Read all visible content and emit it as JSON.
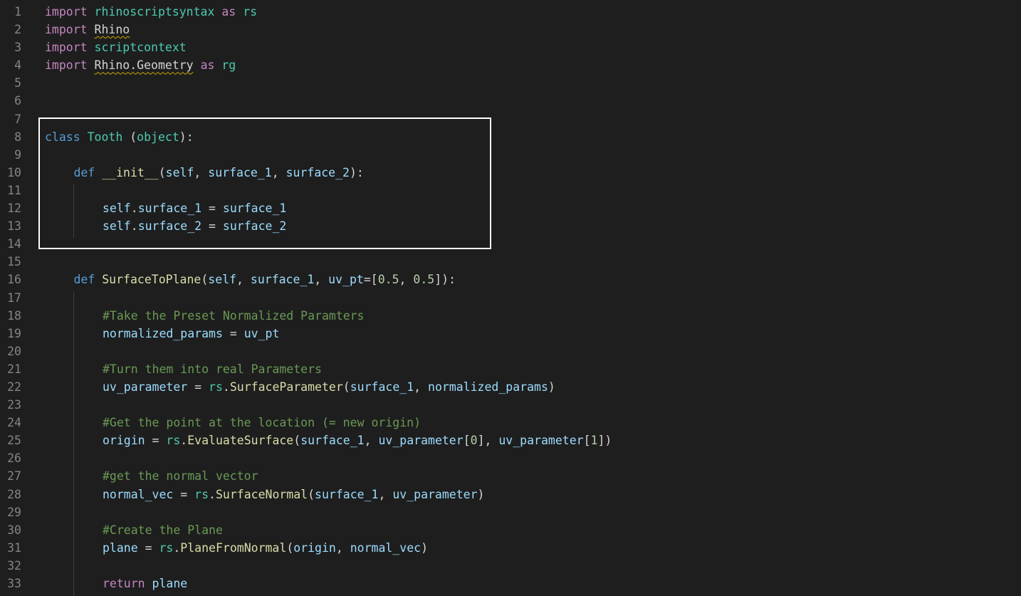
{
  "lines": [
    {
      "n": "1",
      "indent": 0,
      "tokens": [
        {
          "t": "import",
          "c": "ctrl"
        },
        {
          "t": " ",
          "c": "pl"
        },
        {
          "t": "rhinoscriptsyntax",
          "c": "cls"
        },
        {
          "t": " ",
          "c": "pl"
        },
        {
          "t": "as",
          "c": "ctrl"
        },
        {
          "t": " ",
          "c": "pl"
        },
        {
          "t": "rs",
          "c": "cls"
        }
      ]
    },
    {
      "n": "2",
      "indent": 0,
      "tokens": [
        {
          "t": "import",
          "c": "ctrl"
        },
        {
          "t": " ",
          "c": "pl"
        },
        {
          "t": "Rhino",
          "c": "pl",
          "squig": true
        }
      ]
    },
    {
      "n": "3",
      "indent": 0,
      "tokens": [
        {
          "t": "import",
          "c": "ctrl"
        },
        {
          "t": " ",
          "c": "pl"
        },
        {
          "t": "scriptcontext",
          "c": "cls"
        }
      ]
    },
    {
      "n": "4",
      "indent": 0,
      "tokens": [
        {
          "t": "import",
          "c": "ctrl"
        },
        {
          "t": " ",
          "c": "pl"
        },
        {
          "t": "Rhino.Geometry",
          "c": "pl",
          "squig": true
        },
        {
          "t": " ",
          "c": "pl"
        },
        {
          "t": "as",
          "c": "ctrl"
        },
        {
          "t": " ",
          "c": "pl"
        },
        {
          "t": "rg",
          "c": "cls"
        }
      ]
    },
    {
      "n": "5",
      "indent": 0,
      "tokens": []
    },
    {
      "n": "6",
      "indent": 0,
      "tokens": []
    },
    {
      "n": "7",
      "indent": 0,
      "tokens": []
    },
    {
      "n": "8",
      "indent": 0,
      "tokens": [
        {
          "t": "class",
          "c": "kw"
        },
        {
          "t": " ",
          "c": "pl"
        },
        {
          "t": "Tooth",
          "c": "cls"
        },
        {
          "t": " (",
          "c": "pl"
        },
        {
          "t": "object",
          "c": "cls"
        },
        {
          "t": "):",
          "c": "pl"
        }
      ]
    },
    {
      "n": "9",
      "indent": 0,
      "tokens": []
    },
    {
      "n": "10",
      "indent": 1,
      "tokens": [
        {
          "t": "def",
          "c": "kw"
        },
        {
          "t": " ",
          "c": "pl"
        },
        {
          "t": "__init__",
          "c": "fn"
        },
        {
          "t": "(",
          "c": "pl"
        },
        {
          "t": "self",
          "c": "var"
        },
        {
          "t": ", ",
          "c": "pl"
        },
        {
          "t": "surface_1",
          "c": "var"
        },
        {
          "t": ", ",
          "c": "pl"
        },
        {
          "t": "surface_2",
          "c": "var"
        },
        {
          "t": "):",
          "c": "pl"
        }
      ]
    },
    {
      "n": "11",
      "indent": 0,
      "tokens": []
    },
    {
      "n": "12",
      "indent": 2,
      "tokens": [
        {
          "t": "self",
          "c": "var"
        },
        {
          "t": ".",
          "c": "pl"
        },
        {
          "t": "surface_1",
          "c": "var"
        },
        {
          "t": " = ",
          "c": "pl"
        },
        {
          "t": "surface_1",
          "c": "var"
        }
      ]
    },
    {
      "n": "13",
      "indent": 2,
      "tokens": [
        {
          "t": "self",
          "c": "var"
        },
        {
          "t": ".",
          "c": "pl"
        },
        {
          "t": "surface_2",
          "c": "var"
        },
        {
          "t": " = ",
          "c": "pl"
        },
        {
          "t": "surface_2",
          "c": "var"
        }
      ]
    },
    {
      "n": "14",
      "indent": 0,
      "tokens": []
    },
    {
      "n": "15",
      "indent": 0,
      "tokens": []
    },
    {
      "n": "16",
      "indent": 1,
      "tokens": [
        {
          "t": "def",
          "c": "kw"
        },
        {
          "t": " ",
          "c": "pl"
        },
        {
          "t": "SurfaceToPlane",
          "c": "fn"
        },
        {
          "t": "(",
          "c": "pl"
        },
        {
          "t": "self",
          "c": "var"
        },
        {
          "t": ", ",
          "c": "pl"
        },
        {
          "t": "surface_1",
          "c": "var"
        },
        {
          "t": ", ",
          "c": "pl"
        },
        {
          "t": "uv_pt",
          "c": "var"
        },
        {
          "t": "=[",
          "c": "pl"
        },
        {
          "t": "0.5",
          "c": "num"
        },
        {
          "t": ", ",
          "c": "pl"
        },
        {
          "t": "0.5",
          "c": "num"
        },
        {
          "t": "]):",
          "c": "pl"
        }
      ]
    },
    {
      "n": "17",
      "indent": 0,
      "tokens": []
    },
    {
      "n": "18",
      "indent": 2,
      "tokens": [
        {
          "t": "#Take the Preset Normalized Paramters",
          "c": "cmt"
        }
      ]
    },
    {
      "n": "19",
      "indent": 2,
      "tokens": [
        {
          "t": "normalized_params",
          "c": "var"
        },
        {
          "t": " = ",
          "c": "pl"
        },
        {
          "t": "uv_pt",
          "c": "var"
        }
      ]
    },
    {
      "n": "20",
      "indent": 0,
      "tokens": []
    },
    {
      "n": "21",
      "indent": 2,
      "tokens": [
        {
          "t": "#Turn them into real Parameters",
          "c": "cmt"
        }
      ]
    },
    {
      "n": "22",
      "indent": 2,
      "tokens": [
        {
          "t": "uv_parameter",
          "c": "var"
        },
        {
          "t": " = ",
          "c": "pl"
        },
        {
          "t": "rs",
          "c": "cls"
        },
        {
          "t": ".",
          "c": "pl"
        },
        {
          "t": "SurfaceParameter",
          "c": "fn"
        },
        {
          "t": "(",
          "c": "pl"
        },
        {
          "t": "surface_1",
          "c": "var"
        },
        {
          "t": ", ",
          "c": "pl"
        },
        {
          "t": "normalized_params",
          "c": "var"
        },
        {
          "t": ")",
          "c": "pl"
        }
      ]
    },
    {
      "n": "23",
      "indent": 0,
      "tokens": []
    },
    {
      "n": "24",
      "indent": 2,
      "tokens": [
        {
          "t": "#Get the point at the location (= new origin)",
          "c": "cmt"
        }
      ]
    },
    {
      "n": "25",
      "indent": 2,
      "tokens": [
        {
          "t": "origin",
          "c": "var"
        },
        {
          "t": " = ",
          "c": "pl"
        },
        {
          "t": "rs",
          "c": "cls"
        },
        {
          "t": ".",
          "c": "pl"
        },
        {
          "t": "EvaluateSurface",
          "c": "fn"
        },
        {
          "t": "(",
          "c": "pl"
        },
        {
          "t": "surface_1",
          "c": "var"
        },
        {
          "t": ", ",
          "c": "pl"
        },
        {
          "t": "uv_parameter",
          "c": "var"
        },
        {
          "t": "[",
          "c": "pl"
        },
        {
          "t": "0",
          "c": "num"
        },
        {
          "t": "], ",
          "c": "pl"
        },
        {
          "t": "uv_parameter",
          "c": "var"
        },
        {
          "t": "[",
          "c": "pl"
        },
        {
          "t": "1",
          "c": "num"
        },
        {
          "t": "])",
          "c": "pl"
        }
      ]
    },
    {
      "n": "26",
      "indent": 0,
      "tokens": []
    },
    {
      "n": "27",
      "indent": 2,
      "tokens": [
        {
          "t": "#get the normal vector",
          "c": "cmt"
        }
      ]
    },
    {
      "n": "28",
      "indent": 2,
      "tokens": [
        {
          "t": "normal_vec",
          "c": "var"
        },
        {
          "t": " = ",
          "c": "pl"
        },
        {
          "t": "rs",
          "c": "cls"
        },
        {
          "t": ".",
          "c": "pl"
        },
        {
          "t": "SurfaceNormal",
          "c": "fn"
        },
        {
          "t": "(",
          "c": "pl"
        },
        {
          "t": "surface_1",
          "c": "var"
        },
        {
          "t": ", ",
          "c": "pl"
        },
        {
          "t": "uv_parameter",
          "c": "var"
        },
        {
          "t": ")",
          "c": "pl"
        }
      ]
    },
    {
      "n": "29",
      "indent": 0,
      "tokens": []
    },
    {
      "n": "30",
      "indent": 2,
      "tokens": [
        {
          "t": "#Create the Plane",
          "c": "cmt"
        }
      ]
    },
    {
      "n": "31",
      "indent": 2,
      "tokens": [
        {
          "t": "plane",
          "c": "var"
        },
        {
          "t": " = ",
          "c": "pl"
        },
        {
          "t": "rs",
          "c": "cls"
        },
        {
          "t": ".",
          "c": "pl"
        },
        {
          "t": "PlaneFromNormal",
          "c": "fn"
        },
        {
          "t": "(",
          "c": "pl"
        },
        {
          "t": "origin",
          "c": "var"
        },
        {
          "t": ", ",
          "c": "pl"
        },
        {
          "t": "normal_vec",
          "c": "var"
        },
        {
          "t": ")",
          "c": "pl"
        }
      ]
    },
    {
      "n": "32",
      "indent": 0,
      "tokens": []
    },
    {
      "n": "33",
      "indent": 2,
      "tokens": [
        {
          "t": "return",
          "c": "ctrl"
        },
        {
          "t": " ",
          "c": "pl"
        },
        {
          "t": "plane",
          "c": "var"
        }
      ]
    }
  ],
  "colors": {
    "background": "#1e1e1e",
    "line_number": "#858585",
    "keyword": "#569cd6",
    "control": "#c586c0",
    "class": "#4ec9b0",
    "function": "#dcdcaa",
    "variable": "#9cdcfe",
    "number": "#b5cea8",
    "comment": "#6a9955",
    "highlight_box": "#ffffff"
  }
}
